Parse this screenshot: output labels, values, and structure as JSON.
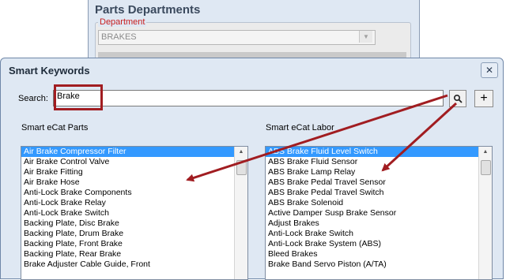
{
  "background_window": {
    "title": "Parts Departments",
    "group_label": "Department",
    "department_value": "BRAKES"
  },
  "dialog": {
    "title": "Smart Keywords",
    "close_glyph": "✕",
    "search_label": "Search:",
    "search_value": "Brake",
    "search_button_glyph": "🔍",
    "add_button_glyph": "+"
  },
  "parts": {
    "title": "Smart eCat Parts",
    "items": [
      "Air Brake Compressor Filter",
      "Air Brake Control Valve",
      "Air Brake Fitting",
      "Air Brake Hose",
      "Anti-Lock Brake Components",
      "Anti-Lock Brake Relay",
      "Anti-Lock Brake Switch",
      "Backing Plate, Disc Brake",
      "Backing Plate, Drum Brake",
      "Backing Plate, Front Brake",
      "Backing Plate, Rear Brake",
      "Brake Adjuster Cable Guide, Front"
    ],
    "selected_index": 0
  },
  "labor": {
    "title": "Smart eCat Labor",
    "items": [
      "ABS Brake Fluid Level Switch",
      "ABS Brake Fluid Sensor",
      "ABS Brake Lamp Relay",
      "ABS Brake Pedal Travel Sensor",
      "ABS Brake Pedal Travel Switch",
      "ABS Brake Solenoid",
      "Active Damper Susp Brake Sensor",
      "Adjust Brakes",
      "Anti-Lock Brake Switch",
      "Anti-Lock Brake System (ABS)",
      "Bleed Brakes",
      "Brake Band Servo Piston (A/TA)"
    ],
    "selected_index": 0
  },
  "colors": {
    "highlight_box": "#a11d21",
    "arrow": "#a11d21",
    "selection": "#3399ff",
    "dialog_bg": "#dfe8f3"
  },
  "icons": {
    "search_button": "magnifier-icon",
    "add_button": "plus-icon",
    "close_button": "close-icon"
  }
}
